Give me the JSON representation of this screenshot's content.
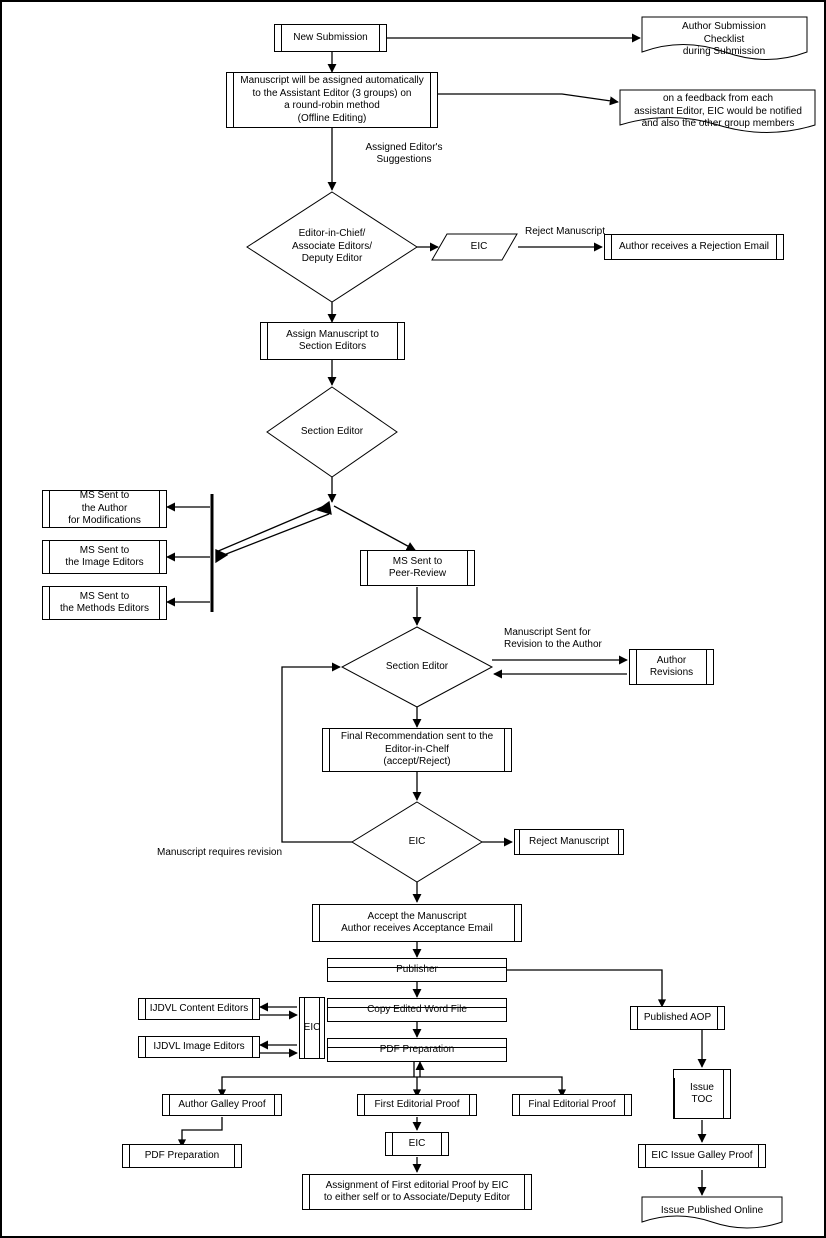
{
  "chart_data": {
    "type": "flowchart",
    "nodes": [
      {
        "id": "new_submission",
        "label": "New Submission",
        "shape": "process"
      },
      {
        "id": "checklist",
        "label": "Author Submission Checklist during Submission",
        "shape": "document"
      },
      {
        "id": "assign_ae",
        "label": "Manuscript will be assigned automatically to the Assistant Editor (3 groups) on a round-robin method (Offline Editing)",
        "shape": "process"
      },
      {
        "id": "feedback",
        "label": "on a feedback from each assistant Editor, EIC would be notified and also the other group members",
        "shape": "document"
      },
      {
        "id": "eic_assoc_dep",
        "label": "Editor-in-Chief/ Associate Editors/ Deputy Editor",
        "shape": "decision"
      },
      {
        "id": "eic_parallelogram",
        "label": "EIC",
        "shape": "data"
      },
      {
        "id": "reject_email",
        "label": "Author receives a Rejection Email",
        "shape": "process"
      },
      {
        "id": "assign_section",
        "label": "Assign Manuscript to Section Editors",
        "shape": "process"
      },
      {
        "id": "section_editor1",
        "label": "Section Editor",
        "shape": "decision"
      },
      {
        "id": "sent_author_mods",
        "label": "MS Sent to the Author for Modifications",
        "shape": "process"
      },
      {
        "id": "sent_image_editors",
        "label": "MS Sent to the Image Editors",
        "shape": "process"
      },
      {
        "id": "sent_methods_editors",
        "label": "MS Sent to the Methods Editors",
        "shape": "process"
      },
      {
        "id": "sent_peer",
        "label": "MS Sent to Peer-Review",
        "shape": "process"
      },
      {
        "id": "section_editor2",
        "label": "Section Editor",
        "shape": "decision"
      },
      {
        "id": "author_revisions",
        "label": "Author Revisions",
        "shape": "process"
      },
      {
        "id": "final_rec",
        "label": "Final Recommendation sent to the Editor-in-Chelf (accept/Reject)",
        "shape": "process"
      },
      {
        "id": "eic_dec",
        "label": "EIC",
        "shape": "decision"
      },
      {
        "id": "reject_manuscript2",
        "label": "Reject Manuscript",
        "shape": "process"
      },
      {
        "id": "accept",
        "label": "Accept the Manuscript Author receives Acceptance Email",
        "shape": "process"
      },
      {
        "id": "publisher",
        "label": "Publisher",
        "shape": "process"
      },
      {
        "id": "copy_edited",
        "label": "Copy Edited Word File",
        "shape": "process"
      },
      {
        "id": "ijdvl_content",
        "label": "IJDVL Content Editors",
        "shape": "process"
      },
      {
        "id": "ijdvl_image",
        "label": "IJDVL Image Editors",
        "shape": "process"
      },
      {
        "id": "eic_small",
        "label": "EIC",
        "shape": "process"
      },
      {
        "id": "pdf_prep",
        "label": "PDF Preparation",
        "shape": "process"
      },
      {
        "id": "published_aop",
        "label": "Published AOP",
        "shape": "process"
      },
      {
        "id": "author_galley",
        "label": "Author Galley Proof",
        "shape": "process"
      },
      {
        "id": "first_editorial_proof",
        "label": "First Editorial Proof",
        "shape": "process"
      },
      {
        "id": "final_editorial_proof",
        "label": "Final Editorial Proof",
        "shape": "process"
      },
      {
        "id": "issue_toc",
        "label": "Issue TOC",
        "shape": "process"
      },
      {
        "id": "pdf_prep2",
        "label": "PDF Preparation",
        "shape": "process"
      },
      {
        "id": "eic_proof",
        "label": "EIC",
        "shape": "process"
      },
      {
        "id": "assign_first_editorial",
        "label": "Assignment of First editorial Proof by EIC to either self or to Associate/Deputy Editor",
        "shape": "process"
      },
      {
        "id": "eic_issue_galley",
        "label": "EIC Issue Galley Proof",
        "shape": "process"
      },
      {
        "id": "issue_published",
        "label": "Issue Published Online",
        "shape": "document"
      }
    ],
    "edges": [
      [
        "new_submission",
        "checklist"
      ],
      [
        "new_submission",
        "assign_ae"
      ],
      [
        "assign_ae",
        "feedback"
      ],
      [
        "assign_ae",
        "eic_assoc_dep",
        "Assigned Editor's Suggestions"
      ],
      [
        "eic_assoc_dep",
        "eic_parallelogram"
      ],
      [
        "eic_parallelogram",
        "reject_email",
        "Reject Manuscript"
      ],
      [
        "eic_assoc_dep",
        "assign_section"
      ],
      [
        "assign_section",
        "section_editor1"
      ],
      [
        "section_editor1",
        "sent_author_mods"
      ],
      [
        "section_editor1",
        "sent_image_editors"
      ],
      [
        "section_editor1",
        "sent_methods_editors"
      ],
      [
        "section_editor1",
        "sent_peer"
      ],
      [
        "sent_peer",
        "section_editor2"
      ],
      [
        "section_editor2",
        "author_revisions",
        "Manuscript Sent for Revision to the Author"
      ],
      [
        "author_revisions",
        "section_editor2"
      ],
      [
        "section_editor2",
        "final_rec"
      ],
      [
        "final_rec",
        "eic_dec"
      ],
      [
        "eic_dec",
        "reject_manuscript2"
      ],
      [
        "eic_dec",
        "section_editor2",
        "Manuscript requires revision"
      ],
      [
        "eic_dec",
        "accept"
      ],
      [
        "accept",
        "publisher"
      ],
      [
        "publisher",
        "copy_edited"
      ],
      [
        "publisher",
        "published_aop"
      ],
      [
        "copy_edited",
        "eic_small"
      ],
      [
        "eic_small",
        "ijdvl_content"
      ],
      [
        "eic_small",
        "ijdvl_image"
      ],
      [
        "copy_edited",
        "pdf_prep"
      ],
      [
        "pdf_prep",
        "author_galley"
      ],
      [
        "pdf_prep",
        "first_editorial_proof"
      ],
      [
        "pdf_prep",
        "final_editorial_proof"
      ],
      [
        "author_galley",
        "pdf_prep2"
      ],
      [
        "first_editorial_proof",
        "eic_proof"
      ],
      [
        "eic_proof",
        "assign_first_editorial"
      ],
      [
        "published_aop",
        "issue_toc"
      ],
      [
        "issue_toc",
        "eic_issue_galley"
      ],
      [
        "eic_issue_galley",
        "issue_published"
      ]
    ]
  },
  "n": {
    "new_submission": "New Submission",
    "checklist": "Author Submission\nChecklist\nduring Submission",
    "assign_ae": "Manuscript will be assigned automatically\nto the Assistant Editor (3 groups) on\na round-robin method\n(Offline Editing)",
    "feedback": "on a feedback from each\nassistant Editor, EIC would be notified\nand also the other group members",
    "eic_assoc_dep": "Editor-in-Chief/\nAssociate Editors/\nDeputy Editor",
    "eic_parallelogram": "EIC",
    "reject_email": "Author receives a Rejection Email",
    "assign_section": "Assign Manuscript to\nSection Editors",
    "section_editor1": "Section Editor",
    "sent_author_mods": "MS Sent to\nthe Author\nfor Modifications",
    "sent_image_editors": "MS Sent to\nthe Image Editors",
    "sent_methods_editors": "MS Sent to\nthe Methods Editors",
    "sent_peer": "MS Sent to\nPeer-Review",
    "section_editor2": "Section Editor",
    "author_revisions": "Author\nRevisions",
    "final_rec": "Final Recommendation sent to the\nEditor-in-Chelf\n(accept/Reject)",
    "eic_dec": "EIC",
    "reject_manuscript2": "Reject Manuscript",
    "accept": "Accept the Manuscript\nAuthor receives Acceptance Email",
    "publisher": "Publisher",
    "copy_edited": "Copy Edited Word File",
    "ijdvl_content": "IJDVL Content Editors",
    "ijdvl_image": "IJDVL Image Editors",
    "eic_small": "EIC",
    "pdf_prep": "PDF Preparation",
    "published_aop": "Published AOP",
    "author_galley": "Author Galley Proof",
    "first_editorial_proof": "First Editorial Proof",
    "final_editorial_proof": "Final Editorial Proof",
    "issue_toc": "Issue\nTOC",
    "pdf_prep2": "PDF Preparation",
    "eic_proof": "EIC",
    "assign_first_editorial": "Assignment of First editorial Proof by EIC\nto either self or to Associate/Deputy Editor",
    "eic_issue_galley": "EIC Issue Galley Proof",
    "issue_published": "Issue Published Online"
  },
  "lbl": {
    "assigned_suggestions": "Assigned Editor's\nSuggestions",
    "reject_ms1": "Reject Manuscript",
    "ms_revision": "Manuscript Sent for\nRevision to the Author",
    "ms_requires_rev": "Manuscript requires revision"
  }
}
